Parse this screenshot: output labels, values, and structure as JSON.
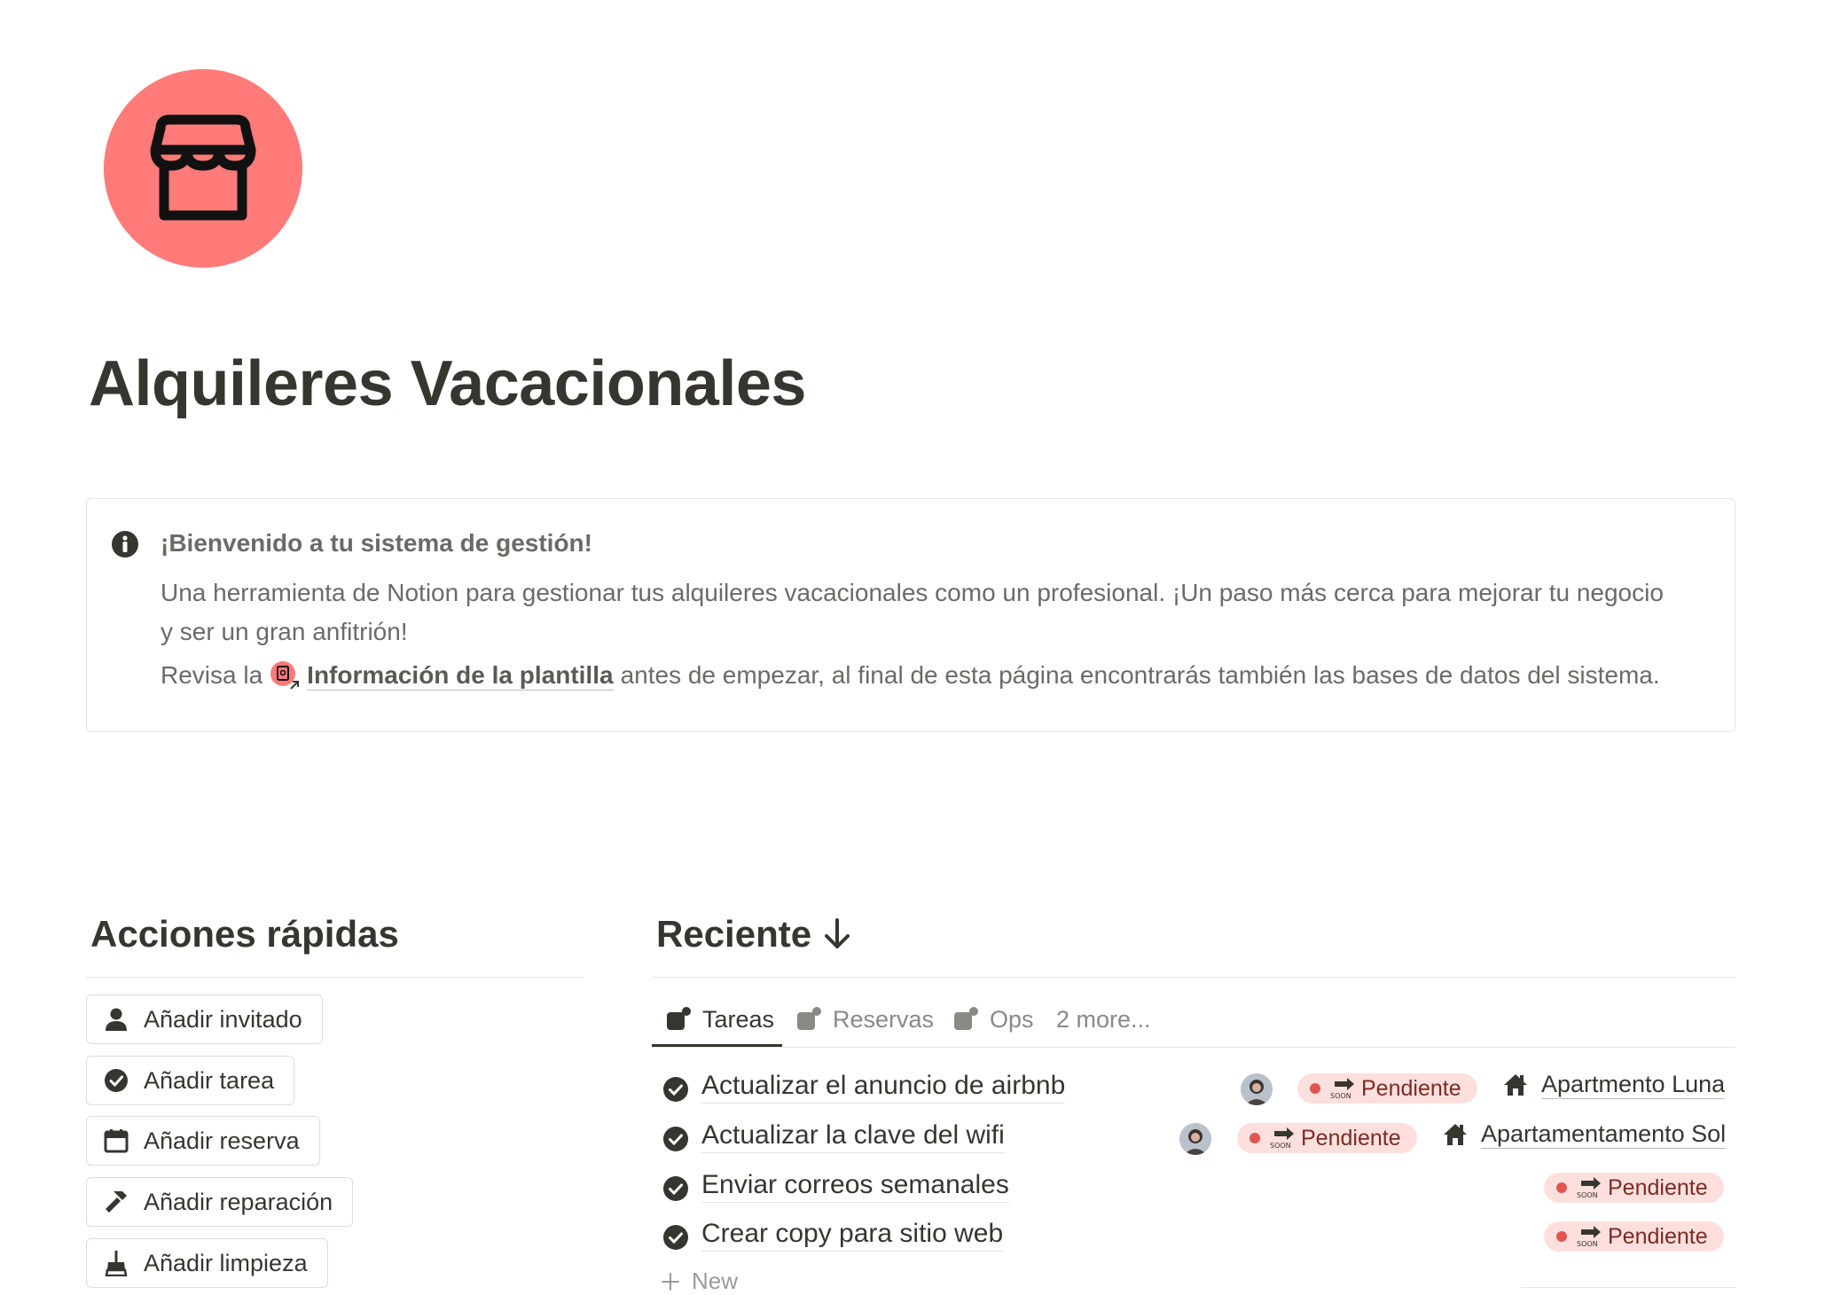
{
  "page": {
    "icon": "storefront-icon",
    "title": "Alquileres Vacacionales"
  },
  "callout": {
    "icon": "info-icon",
    "title": "¡Bienvenido a tu sistema de gestión!",
    "body": "Una herramienta de Notion para gestionar tus alquileres vacacionales como un profesional. ¡Un paso más cerca para mejorar tu negocio y ser un gran anfitrión!",
    "line3_prefix": "Revisa la",
    "link_label": "Información de la plantilla",
    "line3_suffix": "antes de empezar, al final de esta página encontrarás también las bases de datos del sistema."
  },
  "quick_actions": {
    "heading": "Acciones rápidas",
    "items": [
      {
        "label": "Añadir invitado",
        "icon": "person-icon"
      },
      {
        "label": "Añadir tarea",
        "icon": "check-circle-icon"
      },
      {
        "label": "Añadir reserva",
        "icon": "calendar-icon"
      },
      {
        "label": "Añadir reparación",
        "icon": "hammer-icon"
      },
      {
        "label": "Añadir limpieza",
        "icon": "broom-icon"
      }
    ]
  },
  "recent": {
    "heading": "Reciente",
    "heading_icon": "arrow-down-icon",
    "tabs": [
      {
        "label": "Tareas",
        "active": true
      },
      {
        "label": "Reservas",
        "active": false
      },
      {
        "label": "Ops",
        "active": false
      },
      {
        "label": "2 more...",
        "active": false
      }
    ],
    "rows": [
      {
        "title": "Actualizar el anuncio de airbnb",
        "status": "Pendiente",
        "property": "Apartmento Luna",
        "has_avatar": true
      },
      {
        "title": "Actualizar la clave del wifi",
        "status": "Pendiente",
        "property": "Apartamentamento Sol",
        "has_avatar": true
      },
      {
        "title": "Enviar correos semanales",
        "status": "Pendiente",
        "property": "",
        "has_avatar": false
      },
      {
        "title": "Crear copy para sitio web",
        "status": "Pendiente",
        "property": "",
        "has_avatar": false
      }
    ],
    "new_label": "New"
  },
  "colors": {
    "accent": "#ff7b79",
    "status_bg": "#fde0dd",
    "status_dot": "#e2554f"
  }
}
